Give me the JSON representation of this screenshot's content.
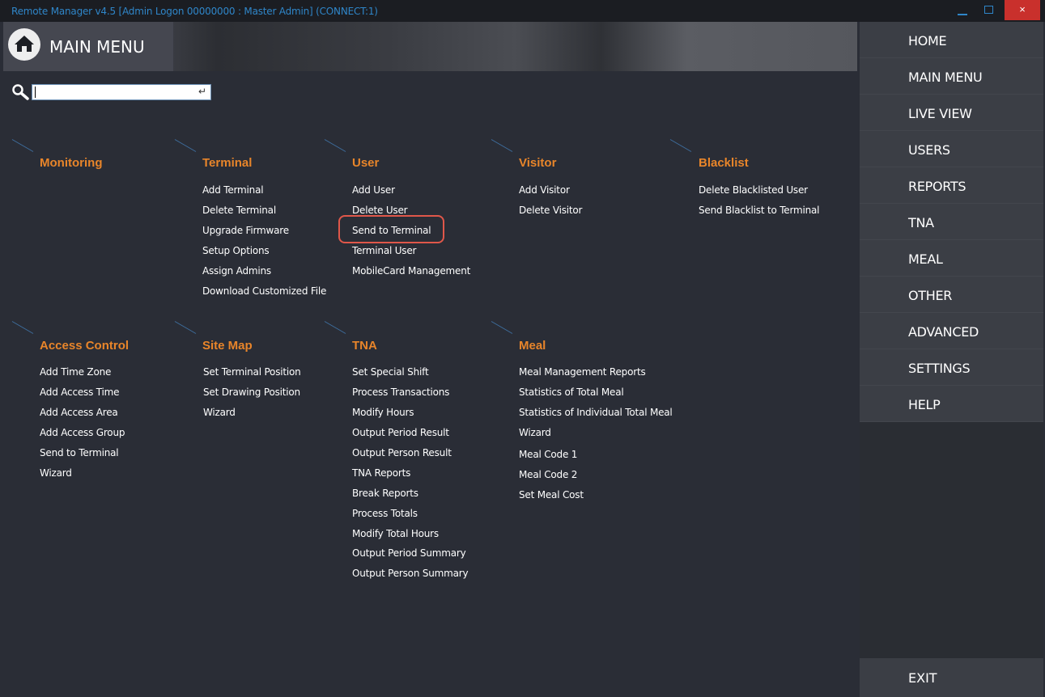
{
  "window": {
    "title": "Remote Manager v4.5 [Admin Logon 00000000 : Master Admin] (CONNECT:1)",
    "close_glyph": "×"
  },
  "header": {
    "title": "MAIN MENU",
    "icon": "home-icon"
  },
  "search": {
    "value": "",
    "enter_glyph": "↵"
  },
  "categories": [
    {
      "title": "Monitoring",
      "items": []
    },
    {
      "title": "Terminal",
      "items": [
        "Add Terminal",
        "Delete Terminal",
        "Upgrade Firmware",
        "Setup Options",
        "Assign Admins",
        "Download Customized File"
      ]
    },
    {
      "title": "User",
      "items": [
        "Add User",
        "Delete User",
        "Send to Terminal",
        "Terminal User",
        "MobileCard Management"
      ]
    },
    {
      "title": "Visitor",
      "items": [
        "Add Visitor",
        "Delete Visitor"
      ]
    },
    {
      "title": "Blacklist",
      "items": [
        "Delete Blacklisted User",
        "Send Blacklist to Terminal"
      ]
    },
    {
      "title": "Access Control",
      "items": [
        "Add Time Zone",
        "Add Access Time",
        "Add Access Area",
        "Add Access Group",
        "Send to Terminal",
        "Wizard"
      ]
    },
    {
      "title": "Site Map",
      "items": [
        "Set Terminal Position",
        "Set Drawing Position",
        "Wizard"
      ]
    },
    {
      "title": "TNA",
      "items": [
        "Set Special Shift",
        "Process Transactions",
        "Modify Hours",
        "Output Period Result",
        "Output Person Result",
        "TNA Reports",
        "Break Reports",
        "Process Totals",
        "Modify Total Hours",
        "Output Period Summary",
        "Output Person Summary"
      ]
    },
    {
      "title": "Meal",
      "items": [
        "Meal Management Reports",
        "Statistics of Total Meal",
        "Statistics of Individual Total Meal",
        "Wizard",
        "Meal Code 1",
        "Meal Code 2",
        "Set Meal Cost"
      ]
    }
  ],
  "sidebar": {
    "items": [
      "HOME",
      "MAIN MENU",
      "LIVE VIEW",
      "USERS",
      "REPORTS",
      "TNA",
      "MEAL",
      "OTHER",
      "ADVANCED",
      "SETTINGS",
      "HELP"
    ],
    "exit": "EXIT"
  },
  "colors": {
    "accent_orange": "#e8852a",
    "highlight_red": "#e0574a",
    "title_blue": "#2f86c9",
    "background": "#2a2d36"
  }
}
